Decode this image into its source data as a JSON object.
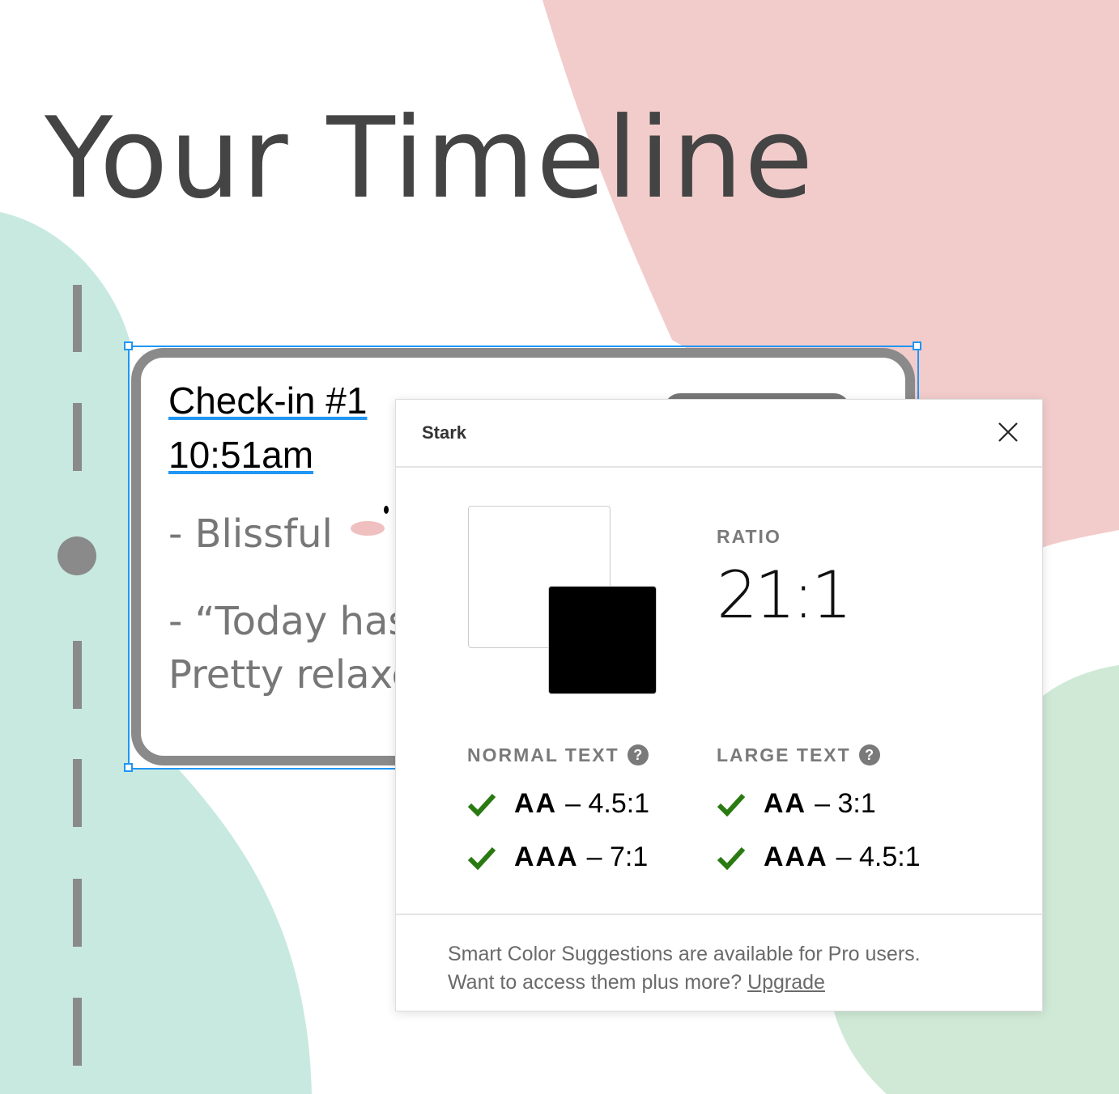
{
  "page": {
    "title": "Your Timeline"
  },
  "colors": {
    "mint": "#c7e9e0",
    "pink": "#f2cccb",
    "green": "#cfe9d6",
    "selection": "#2196f3",
    "check": "#2a7a12"
  },
  "card": {
    "heading": "Check-in #1",
    "time": "10:51am",
    "mood": "- Blissful",
    "quote_line1": "- “Today has",
    "quote_line2": "Pretty relaxed"
  },
  "stark": {
    "name": "Stark",
    "close_icon": "close-icon",
    "ratio_label": "RATIO",
    "ratio_value": "21:1",
    "foreground": "#000000",
    "background": "#ffffff",
    "normal_text": {
      "label": "NORMAL TEXT",
      "help": "?",
      "checks": [
        {
          "level": "AA",
          "value": "– 4.5:1",
          "pass": true
        },
        {
          "level": "AAA",
          "value": "– 7:1",
          "pass": true
        }
      ]
    },
    "large_text": {
      "label": "LARGE TEXT",
      "help": "?",
      "checks": [
        {
          "level": "AA",
          "value": "– 3:1",
          "pass": true
        },
        {
          "level": "AAA",
          "value": "– 4.5:1",
          "pass": true
        }
      ]
    },
    "footer_line1": "Smart Color Suggestions are available for Pro users.",
    "footer_line2": "Want to access them plus more? ",
    "upgrade_link": "Upgrade"
  }
}
